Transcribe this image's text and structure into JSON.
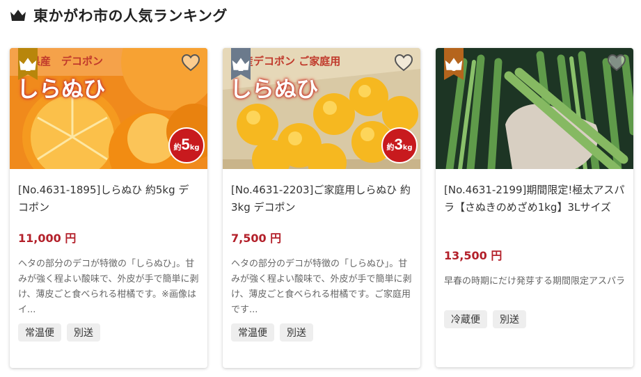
{
  "page": {
    "title": "東かがわ市の人気ランキング",
    "icon": "crown-icon",
    "colors": {
      "crown": "#222222",
      "price": "#b3202a",
      "badge_gold": "#b8860b",
      "badge_slate": "#6b7a8c",
      "badge_bronze": "#b5651d"
    }
  },
  "products": [
    {
      "rank": "1",
      "name": "[No.4631-1895]しらぬひ 約5kg デコポン",
      "price": "11,000 円",
      "description": "ヘタの部分のデコが特徴の「しらぬひ」。甘みが強く程よい酸味で、外皮が手で簡単に剥け、薄皮ごと食べられる柑橘です。※画像はイ...",
      "tags": [
        "常温便",
        "別送"
      ],
      "photo_caption": "川県産　デコポン",
      "photo_title": "しらぬひ",
      "weight_badge": {
        "pre": "約",
        "num": "5",
        "unit": "kg"
      }
    },
    {
      "rank": "2",
      "name": "[No.4631-2203]ご家庭用しらぬひ 約3kg デコポン",
      "price": "7,500 円",
      "description": "ヘタの部分のデコが特徴の「しらぬひ」。甘みが強く程よい酸味で、外皮が手で簡単に剥け、薄皮ごと食べられる柑橘です。ご家庭用です...",
      "tags": [
        "常温便",
        "別送"
      ],
      "photo_caption": "県産デコポン ご家庭用",
      "photo_title": "しらぬひ",
      "weight_badge": {
        "pre": "約",
        "num": "3",
        "unit": "kg"
      }
    },
    {
      "rank": "3",
      "name": "[No.4631-2199]期間限定!極太アスパラ【さぬきのめざめ1kg】3Lサイズ",
      "price": "13,500 円",
      "description": "早春の時期にだけ発芽する期間限定アスパラ",
      "tags": [
        "冷蔵便",
        "別送"
      ]
    }
  ]
}
